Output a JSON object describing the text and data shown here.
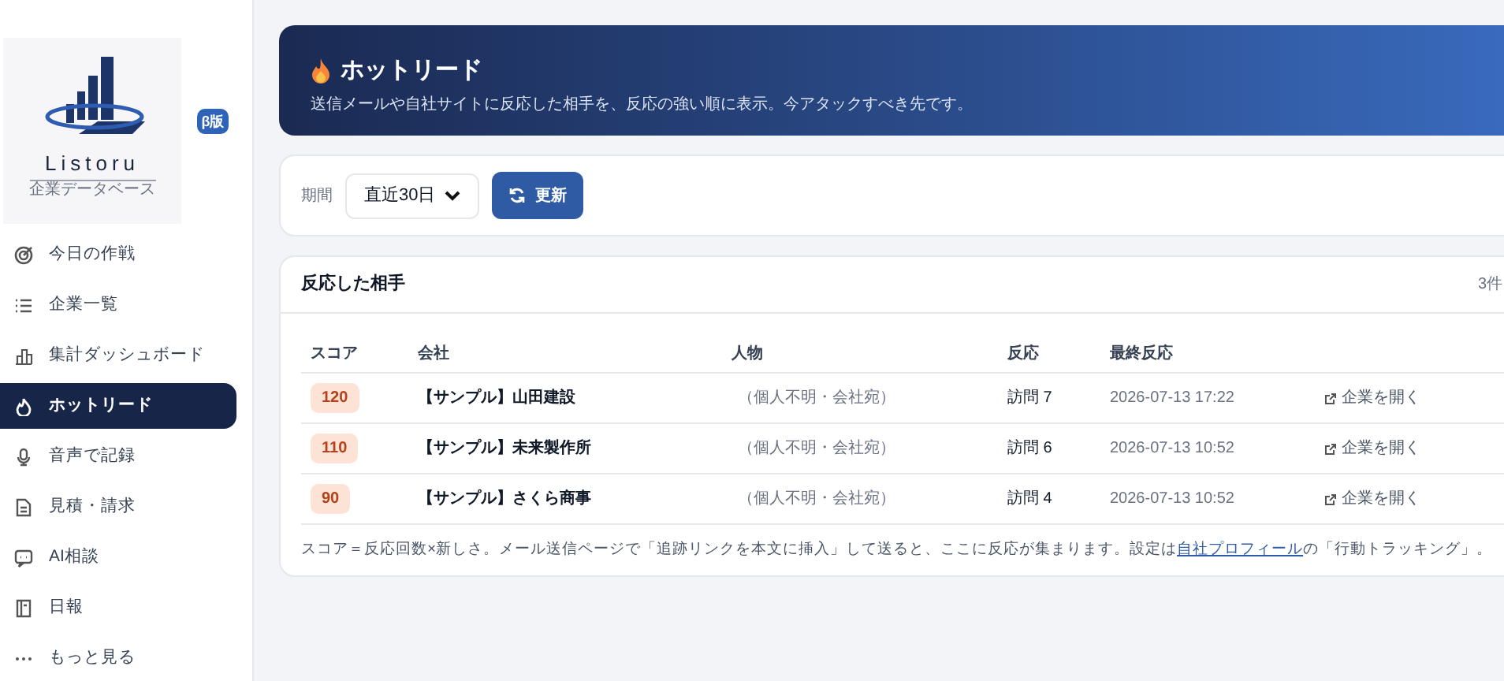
{
  "sidebar": {
    "logo": {
      "name": "Listoru",
      "tagline": "企業データベース"
    },
    "badge": "β版",
    "items": [
      {
        "label": "今日の作戦",
        "selected": false
      },
      {
        "label": "企業一覧",
        "selected": false
      },
      {
        "label": "集計ダッシュボード",
        "selected": false
      },
      {
        "label": "ホットリード",
        "selected": true
      },
      {
        "label": "音声で記録",
        "selected": false
      },
      {
        "label": "見積・請求",
        "selected": false
      },
      {
        "label": "AI相談",
        "selected": false
      },
      {
        "label": "日報",
        "selected": false
      },
      {
        "label": "もっと見る",
        "selected": false
      }
    ]
  },
  "header": {
    "title": "ホットリード",
    "subtitle": "送信メールや自社サイトに反応した相手を、反応の強い順に表示。今アタックすべき先です。"
  },
  "filter": {
    "label": "期間",
    "period": "直近30日",
    "button": "更新"
  },
  "table": {
    "title": "反応した相手",
    "count": "3件",
    "columns": [
      "スコア",
      "会社",
      "人物",
      "反応",
      "最終反応"
    ],
    "rows": [
      {
        "score": "120",
        "company": "【サンプル】山田建設",
        "person": "（個人不明・会社宛）",
        "reaction": "訪問 7",
        "last": "2026-07-13 17:22",
        "action": "企業を開く"
      },
      {
        "score": "110",
        "company": "【サンプル】未来製作所",
        "person": "（個人不明・会社宛）",
        "reaction": "訪問 6",
        "last": "2026-07-13 10:52",
        "action": "企業を開く"
      },
      {
        "score": "90",
        "company": "【サンプル】さくら商事",
        "person": "（個人不明・会社宛）",
        "reaction": "訪問 4",
        "last": "2026-07-13 10:52",
        "action": "企業を開く"
      }
    ],
    "note": {
      "text": "スコア＝反応回数×新しさ。メール送信ページで「追跡リンクを本文に挿入」して送ると、ここに反応が集まります。設定は",
      "link": "自社プロフィール",
      "text_after": "の「行動トラッキング」。"
    }
  }
}
